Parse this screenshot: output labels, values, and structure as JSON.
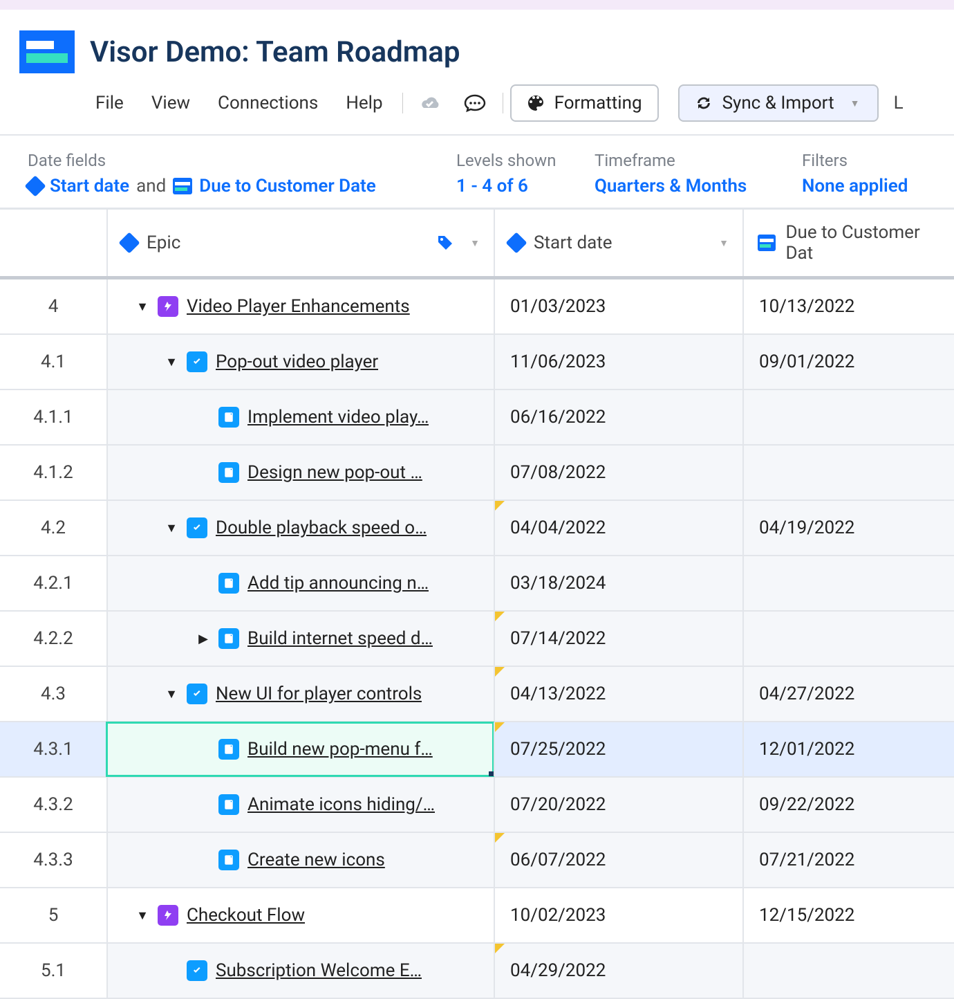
{
  "header": {
    "title": "Visor Demo: Team Roadmap"
  },
  "menu": {
    "file": "File",
    "view": "View",
    "connections": "Connections",
    "help": "Help",
    "formatting": "Formatting",
    "sync": "Sync & Import",
    "truncated": "L"
  },
  "toolbar": {
    "date_fields_label": "Date fields",
    "start_date": "Start date",
    "and": "and",
    "due_date": "Due to Customer Date",
    "levels_label": "Levels shown",
    "levels_val": "1 - 4 of 6",
    "timeframe_label": "Timeframe",
    "timeframe_val": "Quarters & Months",
    "filters_label": "Filters",
    "filters_val": "None applied"
  },
  "columns": {
    "epic": "Epic",
    "start": "Start date",
    "due": "Due to Customer Dat"
  },
  "rows": [
    {
      "num": "4",
      "indent": 1,
      "type": "purple",
      "chev": "down",
      "title": "Video Player Enhancements",
      "start": "01/03/2023",
      "due": "10/13/2022",
      "alt": false,
      "flag": false,
      "sel": false
    },
    {
      "num": "4.1",
      "indent": 2,
      "type": "check",
      "chev": "down",
      "title": "Pop-out video player",
      "start": "11/06/2023",
      "due": "09/01/2022",
      "alt": true,
      "flag": false,
      "sel": false
    },
    {
      "num": "4.1.1",
      "indent": 3,
      "type": "doc",
      "chev": "",
      "title": "Implement video play…",
      "start": "06/16/2022",
      "due": "",
      "alt": true,
      "flag": false,
      "sel": false
    },
    {
      "num": "4.1.2",
      "indent": 3,
      "type": "doc",
      "chev": "",
      "title": "Design new pop-out …",
      "start": "07/08/2022",
      "due": "",
      "alt": true,
      "flag": false,
      "sel": false
    },
    {
      "num": "4.2",
      "indent": 2,
      "type": "check",
      "chev": "down",
      "title": "Double playback speed o…",
      "start": "04/04/2022",
      "due": "04/19/2022",
      "alt": true,
      "flag": true,
      "sel": false
    },
    {
      "num": "4.2.1",
      "indent": 3,
      "type": "doc",
      "chev": "",
      "title": "Add tip announcing n…",
      "start": "03/18/2024",
      "due": "",
      "alt": true,
      "flag": false,
      "sel": false
    },
    {
      "num": "4.2.2",
      "indent": 3,
      "type": "doc",
      "chev": "right",
      "title": "Build internet speed d…",
      "start": "07/14/2022",
      "due": "",
      "alt": true,
      "flag": true,
      "sel": false
    },
    {
      "num": "4.3",
      "indent": 2,
      "type": "check",
      "chev": "down",
      "title": "New UI for player controls",
      "start": "04/13/2022",
      "due": "04/27/2022",
      "alt": true,
      "flag": true,
      "sel": false
    },
    {
      "num": "4.3.1",
      "indent": 3,
      "type": "doc",
      "chev": "",
      "title": "Build new pop-menu f…",
      "start": "07/25/2022",
      "due": "12/01/2022",
      "alt": true,
      "flag": true,
      "sel": true
    },
    {
      "num": "4.3.2",
      "indent": 3,
      "type": "doc",
      "chev": "",
      "title": "Animate icons hiding/…",
      "start": "07/20/2022",
      "due": "09/22/2022",
      "alt": true,
      "flag": false,
      "sel": false
    },
    {
      "num": "4.3.3",
      "indent": 3,
      "type": "doc",
      "chev": "",
      "title": "Create new icons",
      "start": "06/07/2022",
      "due": "07/21/2022",
      "alt": true,
      "flag": true,
      "sel": false
    },
    {
      "num": "5",
      "indent": 1,
      "type": "purple",
      "chev": "down",
      "title": "Checkout Flow",
      "start": "10/02/2023",
      "due": "12/15/2022",
      "alt": false,
      "flag": false,
      "sel": false
    },
    {
      "num": "5.1",
      "indent": 2,
      "type": "check",
      "chev": "",
      "title": "Subscription Welcome E…",
      "start": "04/29/2022",
      "due": "",
      "alt": true,
      "flag": true,
      "sel": false
    }
  ]
}
